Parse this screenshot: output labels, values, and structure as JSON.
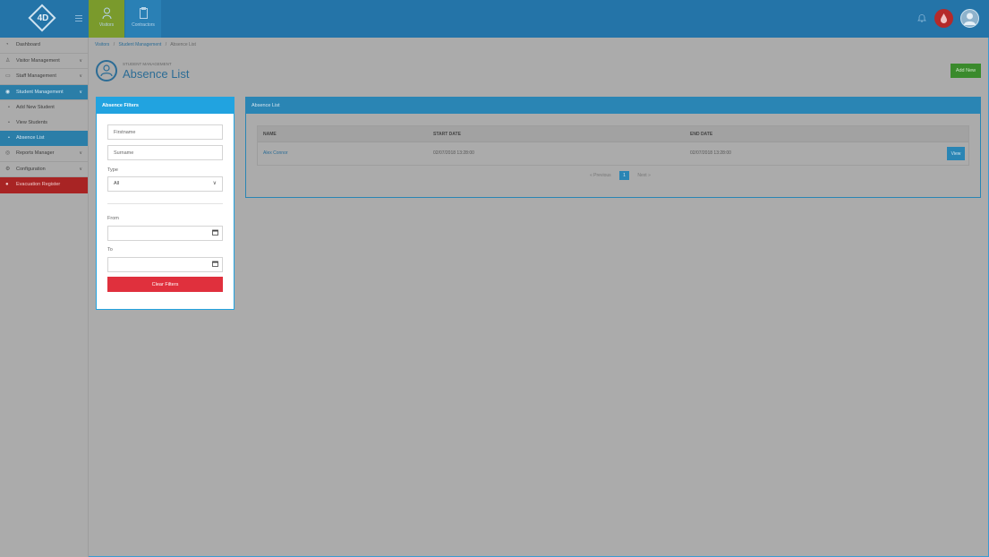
{
  "topbar": {
    "logo_text": "4D",
    "tabs": [
      {
        "label": "Visitors",
        "icon": "person-icon"
      },
      {
        "label": "Contractors",
        "icon": "clipboard-icon"
      }
    ],
    "colors": {
      "bar": "#2474a8",
      "active_tab": "#7a9a2c",
      "alert": "#b52a2a"
    }
  },
  "sidebar": {
    "items": [
      {
        "label": "Dashboard",
        "icon": "dashboard-icon"
      },
      {
        "label": "Visitor Management",
        "icon": "person-icon"
      },
      {
        "label": "Staff Management",
        "icon": "staff-icon"
      },
      {
        "label": "Student Management",
        "icon": "student-icon"
      },
      {
        "label": "Reports Manager",
        "icon": "reports-icon"
      },
      {
        "label": "Configuration",
        "icon": "gear-icon"
      },
      {
        "label": "Evacuation Register",
        "icon": "flame-icon"
      }
    ],
    "sub_items": [
      {
        "label": "Add New Student"
      },
      {
        "label": "View Students"
      },
      {
        "label": "Absence List"
      }
    ]
  },
  "breadcrumb": {
    "items": [
      "Visitors",
      "Student Management",
      "Absence List"
    ]
  },
  "header": {
    "subtitle": "STUDENT MANAGEMENT",
    "title": "Absence List",
    "add_new_label": "Add New"
  },
  "filters": {
    "title": "Absence Filters",
    "firstname_placeholder": "Firstname",
    "surname_placeholder": "Surname",
    "type_label": "Type",
    "type_value": "All",
    "from_label": "From",
    "to_label": "To",
    "clear_label": "Clear Filters"
  },
  "list": {
    "title": "Absence List",
    "columns": [
      "NAME",
      "START DATE",
      "END DATE"
    ],
    "rows": [
      {
        "name": "Alex Connor",
        "start": "02/07/2018 13:28:00",
        "end": "02/07/2018 13:28:00",
        "action": "View"
      }
    ],
    "pagination": {
      "previous": "Previous",
      "current": "1",
      "next": "Next"
    }
  }
}
